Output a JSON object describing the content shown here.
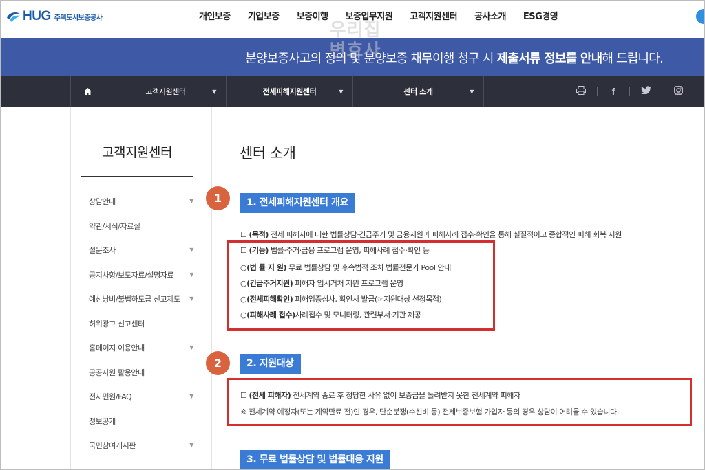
{
  "header": {
    "logo": {
      "brand": "HUG",
      "subtitle": "주택도시보증공사"
    },
    "gnb": [
      "개인보증",
      "기업보증",
      "보증이행",
      "보증업무지원",
      "고객지원센터",
      "공사소개",
      "ESG경영"
    ]
  },
  "banner": {
    "text_pre": "분양보증사고의 정의 및 분양보증 채무이행 청구 시 ",
    "text_bold": "제출서류 정보를 안내",
    "text_post": "해 드립니다."
  },
  "watermark": {
    "line1": "우리집",
    "line2": "변호사"
  },
  "subnav": {
    "level1": "고객지원센터",
    "level2": "전세피해지원센터",
    "level3": "센터 소개",
    "icons": [
      "print-icon",
      "facebook-icon",
      "twitter-icon",
      "instagram-icon"
    ]
  },
  "sidebar": {
    "title": "고객지원센터",
    "items": [
      {
        "label": "상담안내",
        "has_sub": true
      },
      {
        "label": "약관/서식/자료실",
        "has_sub": false
      },
      {
        "label": "설문조사",
        "has_sub": true
      },
      {
        "label": "공지사항/보도자료/설명자료",
        "has_sub": true
      },
      {
        "label": "예산낭비/불법하도급 신고제도",
        "has_sub": true
      },
      {
        "label": "허위광고 신고센터",
        "has_sub": false
      },
      {
        "label": "홈페이지 이용안내",
        "has_sub": true
      },
      {
        "label": "공공자원 활용안내",
        "has_sub": false
      },
      {
        "label": "전자민원/FAQ",
        "has_sub": true
      },
      {
        "label": "정보공개",
        "has_sub": false
      },
      {
        "label": "국민참여게시판",
        "has_sub": true
      }
    ]
  },
  "main": {
    "page_title": "센터 소개",
    "callouts": [
      "1",
      "2"
    ],
    "section1": {
      "heading": "1. 전세피해지원센터 개요",
      "purpose_label": "(목적)",
      "purpose_text": " 전세 피해자에 대한 법률상담·긴급주거 및 금융지원과 피해사례 접수·확인을 통해 실질적이고 종합적인 피해 회복 지원",
      "function_label": "(기능)",
      "function_text": " 법률·주거·금융 프로그램 운영, 피해사례 접수·확인 등",
      "items": [
        {
          "label": "(법 률 지 원)",
          "text": " 무료 법률상담 및 후속법적 조치 법률전문가 Pool 안내"
        },
        {
          "label": "(긴급주거지원)",
          "text": " 피해자 임시거처 지원 프로그램 운영"
        },
        {
          "label": "(전세피해확인)",
          "text": " 피해임증심사, 확인서 발급(☞지원대상 선정목적)"
        },
        {
          "label": "(피해사례 접수)",
          "text": "사례접수 및 모니터링, 관련부서·기관 제공"
        }
      ]
    },
    "section2": {
      "heading": "2. 지원대상",
      "target_label": "(전세 피해자)",
      "target_text": " 전세계약 종료 후 정당한 사유 없이 보증금을 돌려받지 못한 전세계약 피해자",
      "note": "※ 전세계약 예정자(또는 계약만료 전)인 경우, 단순분쟁(수선비 등) 전세보증보험 가입자 등의 경우 상담이 어려울 수 있습니다."
    },
    "section3": {
      "heading": "3. 무료 법률상담 및 법률대응 지원"
    }
  },
  "colors": {
    "banner": "#3e5aa7",
    "subnav": "#2d2f3a",
    "badge": "#3a7bd5",
    "callout": "#d9623f",
    "highlight_box": "#d32f2f",
    "brand": "#1b5aa6"
  }
}
